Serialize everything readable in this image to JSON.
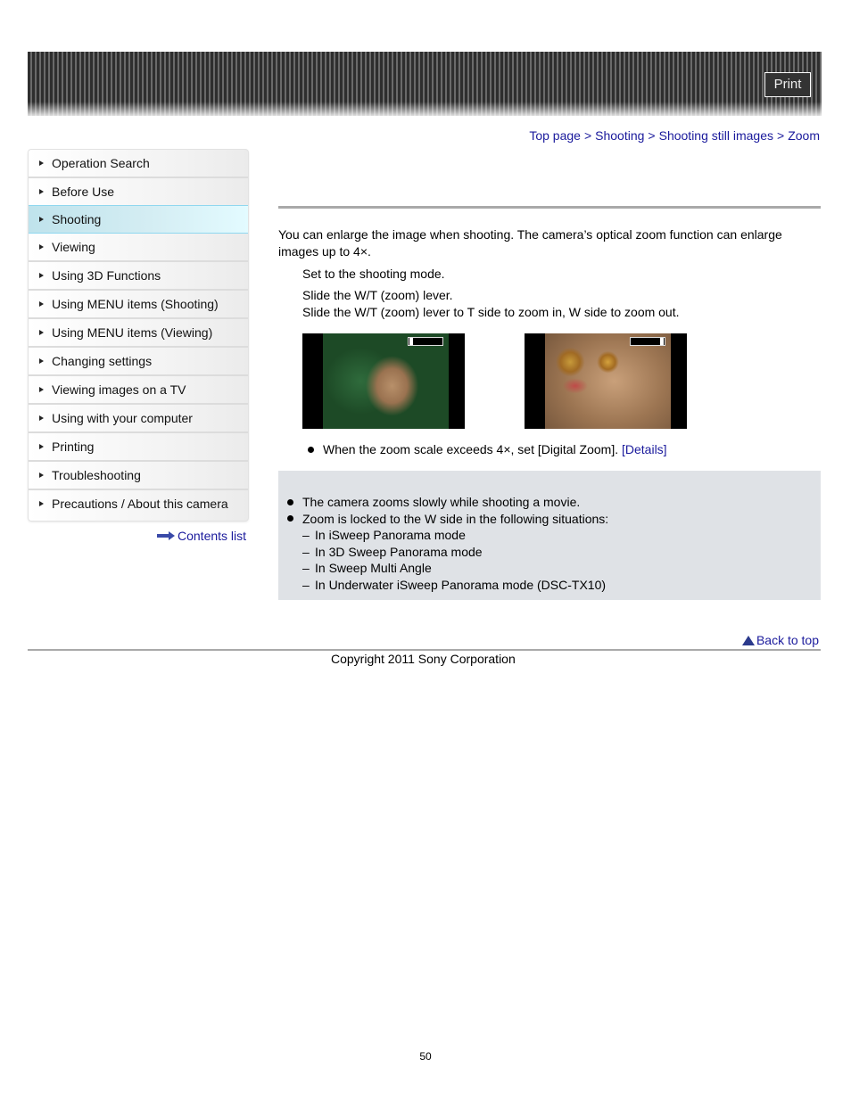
{
  "header": {
    "print_label": "Print"
  },
  "breadcrumb": {
    "items": [
      "Top page",
      "Shooting",
      "Shooting still images",
      "Zoom"
    ],
    "separator": ">"
  },
  "sidebar": {
    "items": [
      {
        "label": "Operation Search",
        "active": false
      },
      {
        "label": "Before Use",
        "active": false
      },
      {
        "label": "Shooting",
        "active": true
      },
      {
        "label": "Viewing",
        "active": false
      },
      {
        "label": "Using 3D Functions",
        "active": false
      },
      {
        "label": "Using MENU items (Shooting)",
        "active": false
      },
      {
        "label": "Using MENU items (Viewing)",
        "active": false
      },
      {
        "label": "Changing settings",
        "active": false
      },
      {
        "label": "Viewing images on a TV",
        "active": false
      },
      {
        "label": "Using with your computer",
        "active": false
      },
      {
        "label": "Printing",
        "active": false
      },
      {
        "label": "Troubleshooting",
        "active": false
      },
      {
        "label": "Precautions / About this camera",
        "active": false
      }
    ],
    "contents_link": "Contents list"
  },
  "main": {
    "intro": "You can enlarge the image when shooting. The camera’s optical zoom function can enlarge images up to 4×.",
    "step1": "Set to the shooting mode.",
    "step2_title": "Slide the W/T (zoom) lever.",
    "step2_detail": "Slide the W/T (zoom) lever to T side to zoom in, W side to zoom out.",
    "images": [
      {
        "alt": "Cat photo at W (wide) side",
        "zoom_position": 0
      },
      {
        "alt": "Cat photo at T (telephoto) side",
        "zoom_position": 1
      }
    ],
    "tip_text": "When the zoom scale exceeds 4×, set [Digital Zoom].",
    "tip_link": "[Details]",
    "notes": {
      "items": [
        "The camera zooms slowly while shooting a movie.",
        "Zoom is locked to the W side in the following situations:"
      ],
      "sub_items": [
        "In iSweep Panorama mode",
        "In 3D Sweep Panorama mode",
        "In Sweep Multi Angle",
        "In Underwater iSweep Panorama mode (DSC-TX10)"
      ],
      "dash": "–"
    }
  },
  "footer": {
    "back_to_top": "Back to top",
    "copyright": "Copyright 2011 Sony Corporation",
    "page_number": "50"
  }
}
